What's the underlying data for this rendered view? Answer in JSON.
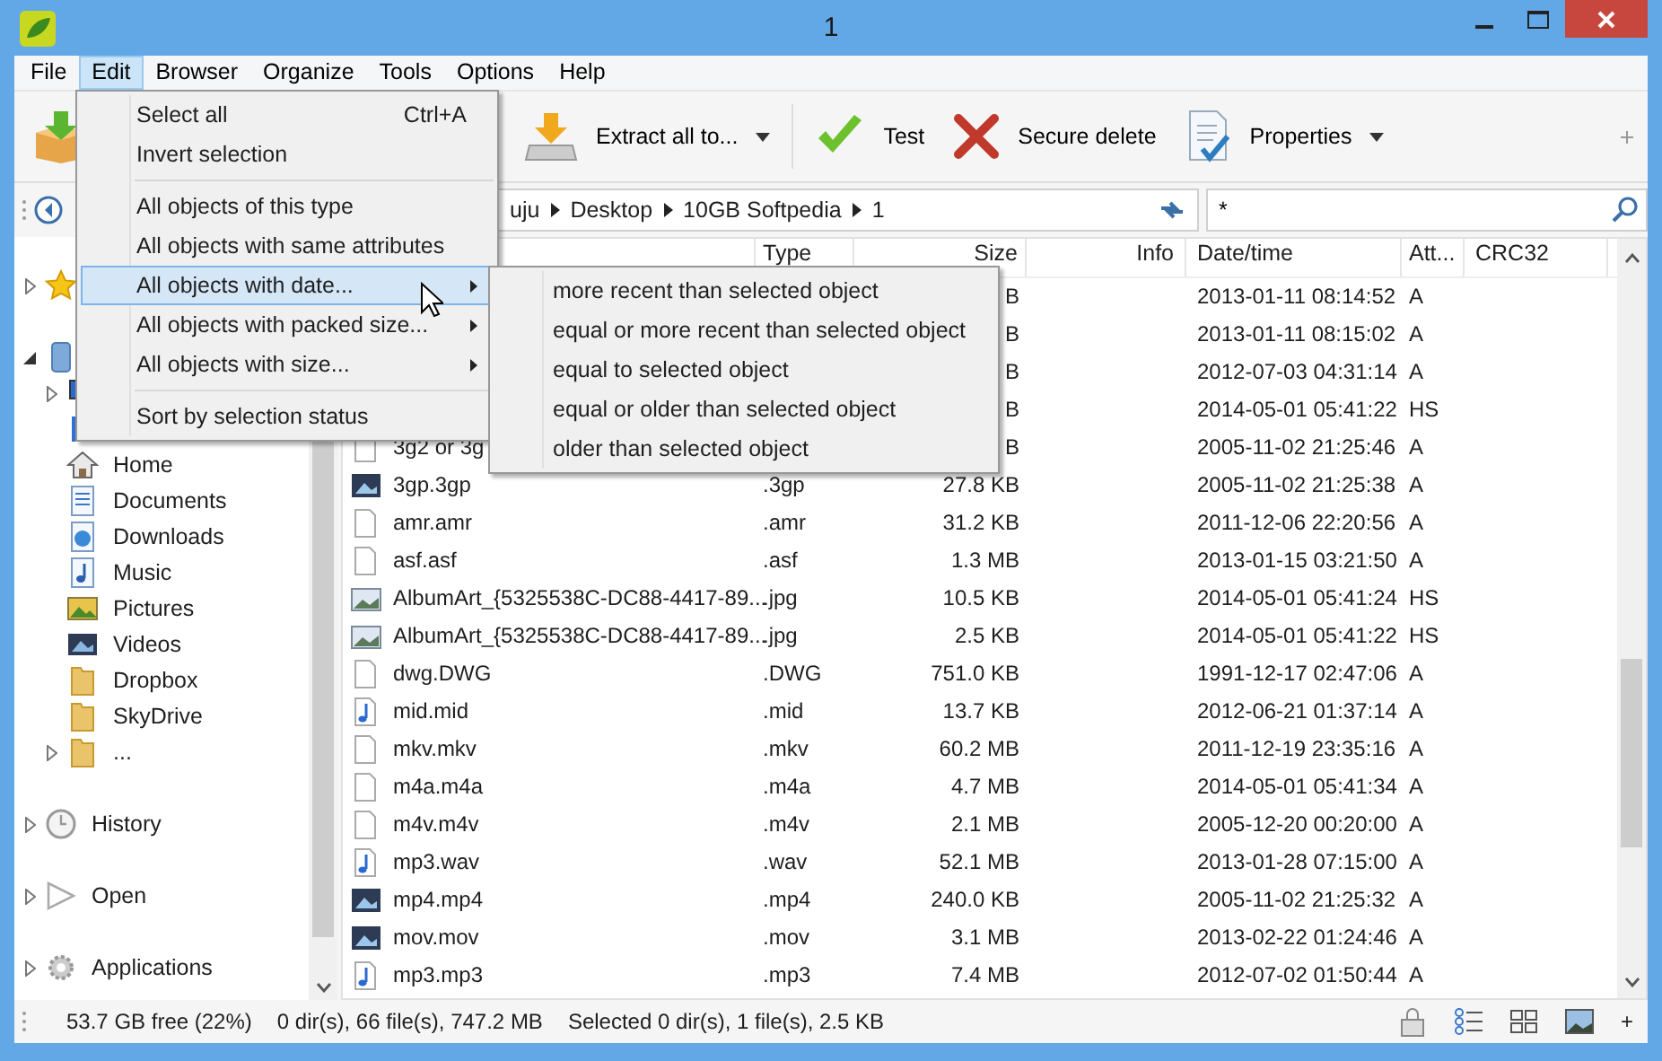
{
  "window": {
    "title": "1"
  },
  "menubar": [
    {
      "label": "File",
      "selected": false
    },
    {
      "label": "Edit",
      "selected": true
    },
    {
      "label": "Browser",
      "selected": false
    },
    {
      "label": "Organize",
      "selected": false
    },
    {
      "label": "Tools",
      "selected": false
    },
    {
      "label": "Options",
      "selected": false
    },
    {
      "label": "Help",
      "selected": false
    }
  ],
  "toolbar": [
    {
      "kind": "add"
    },
    {
      "kind": "extract",
      "label": "Extract all to...",
      "dropdown": true
    },
    {
      "kind": "test",
      "label": "Test",
      "dropdown": false
    },
    {
      "kind": "delete",
      "label": "Secure delete",
      "dropdown": false
    },
    {
      "kind": "properties",
      "label": "Properties",
      "dropdown": true
    }
  ],
  "address": {
    "path": [
      "uju",
      "Desktop",
      "10GB Softpedia",
      "1"
    ],
    "filter": "*"
  },
  "sidebar": [
    {
      "kind": "favorites",
      "expanded": false
    },
    {
      "kind": "drive",
      "expanded": true,
      "children": [
        {
          "kind": "computer",
          "expanded": false
        },
        {
          "kind": "library"
        },
        {
          "kind": "home",
          "label": "Home"
        },
        {
          "kind": "documents",
          "label": "Documents"
        },
        {
          "kind": "downloads",
          "label": "Downloads"
        },
        {
          "kind": "music",
          "label": "Music"
        },
        {
          "kind": "pictures",
          "label": "Pictures"
        },
        {
          "kind": "videos",
          "label": "Videos"
        },
        {
          "kind": "folder",
          "label": "Dropbox"
        },
        {
          "kind": "folder",
          "label": "SkyDrive"
        },
        {
          "kind": "folder",
          "label": "...",
          "expanded": false
        }
      ]
    },
    {
      "kind": "history",
      "label": "History",
      "expanded": false
    },
    {
      "kind": "open",
      "label": "Open",
      "expanded": false
    },
    {
      "kind": "apps",
      "label": "Applications",
      "expanded": false
    }
  ],
  "table": {
    "columns": [
      "Type",
      "Size",
      "Info",
      "Date/time",
      "Att...",
      "CRC32"
    ],
    "rows": [
      {
        "size": "B",
        "date": "2013-01-11 08:14:52",
        "attr": "A"
      },
      {
        "size": "B",
        "date": "2013-01-11 08:15:02",
        "attr": "A"
      },
      {
        "size": "B",
        "date": "2012-07-03 04:31:14",
        "attr": "A"
      },
      {
        "size": "B",
        "date": "2014-05-01 05:41:22",
        "attr": "HS"
      },
      {
        "kind": "blank",
        "name": "3g2 or 3g",
        "size": "B",
        "date": "2005-11-02 21:25:46",
        "attr": "A"
      },
      {
        "kind": "video",
        "name": "3gp.3gp",
        "type": ".3gp",
        "size": "27.8 KB",
        "date": "2005-11-02 21:25:38",
        "attr": "A"
      },
      {
        "kind": "blank",
        "name": "amr.amr",
        "type": ".amr",
        "size": "31.2 KB",
        "date": "2011-12-06 22:20:56",
        "attr": "A"
      },
      {
        "kind": "blank",
        "name": "asf.asf",
        "type": ".asf",
        "size": "1.3 MB",
        "date": "2013-01-15 03:21:50",
        "attr": "A"
      },
      {
        "kind": "image",
        "name": "AlbumArt_{5325538C-DC88-4417-89...",
        "type": ".jpg",
        "size": "10.5 KB",
        "date": "2014-05-01 05:41:24",
        "attr": "HS"
      },
      {
        "kind": "image",
        "name": "AlbumArt_{5325538C-DC88-4417-89...",
        "type": ".jpg",
        "size": "2.5 KB",
        "date": "2014-05-01 05:41:22",
        "attr": "HS"
      },
      {
        "kind": "blank",
        "name": "dwg.DWG",
        "type": ".DWG",
        "size": "751.0 KB",
        "date": "1991-12-17 02:47:06",
        "attr": "A"
      },
      {
        "kind": "audio",
        "name": "mid.mid",
        "type": ".mid",
        "size": "13.7 KB",
        "date": "2012-06-21 01:37:14",
        "attr": "A"
      },
      {
        "kind": "blank",
        "name": "mkv.mkv",
        "type": ".mkv",
        "size": "60.2 MB",
        "date": "2011-12-19 23:35:16",
        "attr": "A"
      },
      {
        "kind": "blank",
        "name": "m4a.m4a",
        "type": ".m4a",
        "size": "4.7 MB",
        "date": "2014-05-01 05:41:34",
        "attr": "A"
      },
      {
        "kind": "blank",
        "name": "m4v.m4v",
        "type": ".m4v",
        "size": "2.1 MB",
        "date": "2005-12-20 00:20:00",
        "attr": "A"
      },
      {
        "kind": "audio",
        "name": "mp3.wav",
        "type": ".wav",
        "size": "52.1 MB",
        "date": "2013-01-28 07:15:00",
        "attr": "A"
      },
      {
        "kind": "video",
        "name": "mp4.mp4",
        "type": ".mp4",
        "size": "240.0 KB",
        "date": "2005-11-02 21:25:32",
        "attr": "A"
      },
      {
        "kind": "video",
        "name": "mov.mov",
        "type": ".mov",
        "size": "3.1 MB",
        "date": "2013-02-22 01:24:46",
        "attr": "A"
      },
      {
        "kind": "audio",
        "name": "mp3.mp3",
        "type": ".mp3",
        "size": "7.4 MB",
        "date": "2012-07-02 01:50:44",
        "attr": "A"
      }
    ]
  },
  "status_bar": {
    "texts": [
      "53.7 GB free (22%)",
      "0 dir(s), 66 file(s), 747.2 MB",
      "Selected 0 dir(s), 1 file(s), 2.5 KB"
    ],
    "extra": "+"
  },
  "edit_menu": {
    "groups": [
      [
        {
          "label": "Select all",
          "shortcut": "Ctrl+A",
          "submenu": false,
          "selected": false
        },
        {
          "label": "Invert selection",
          "submenu": false,
          "selected": false
        }
      ],
      [
        {
          "label": "All objects of this type",
          "submenu": false,
          "selected": false
        },
        {
          "label": "All objects with same attributes",
          "submenu": false,
          "selected": false
        },
        {
          "label": "All objects with date...",
          "submenu": true,
          "selected": true
        },
        {
          "label": "All objects with packed size...",
          "submenu": true,
          "selected": false
        },
        {
          "label": "All objects with size...",
          "submenu": true,
          "selected": false
        }
      ],
      [
        {
          "label": "Sort by selection status",
          "submenu": false,
          "selected": false
        }
      ]
    ]
  },
  "submenu": [
    "more recent than selected object",
    "equal or more recent than selected object",
    "equal to selected object",
    "equal or older than selected object",
    "older than selected object"
  ]
}
